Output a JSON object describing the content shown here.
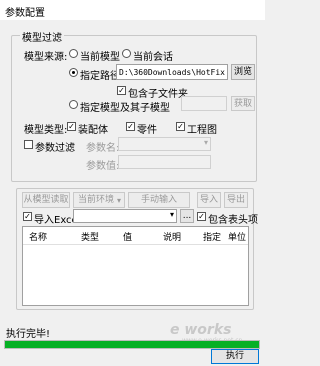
{
  "window": {
    "title": "参数配置"
  },
  "model_filter": {
    "legend": "模型过滤",
    "source_label": "模型来源:",
    "source_current_model": "当前模型",
    "source_current_session": "当前会话",
    "specified_path_label": "指定路径",
    "path_value": "D:\\360Downloads\\HotFix",
    "browse_button": "浏览",
    "include_subfolders": "包含子文件夹",
    "specified_model_label": "指定模型及其子模型",
    "get_button": "获取",
    "model_type_label": "模型类型:",
    "type_assembly": "装配体",
    "type_part": "零件",
    "type_drawing": "工程图",
    "param_filter_label": "参数过滤",
    "param_name_label": "参数名:",
    "param_value_label": "参数值:"
  },
  "toolbar": {
    "read_from_model": "从模型读取",
    "current_env": "当前环境",
    "manual_input": "手动输入",
    "import": "导入",
    "export": "导出"
  },
  "excel": {
    "import_excel_label": "导入Excel",
    "browse_dots": "...",
    "include_header": "包含表头项"
  },
  "table": {
    "columns": [
      "名称",
      "类型",
      "值",
      "说明",
      "指定",
      "单位"
    ]
  },
  "status": {
    "message": "执行完毕!",
    "progress_percent": 100,
    "execute_button": "执行"
  },
  "watermark": {
    "text": "e works",
    "sub": "www.e-works.net.cn"
  }
}
